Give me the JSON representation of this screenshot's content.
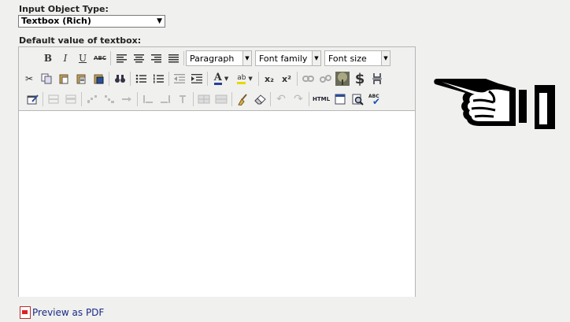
{
  "form": {
    "input_type_label": "Input Object Type:",
    "input_type_value": "Textbox (Rich)",
    "default_value_label": "Default value of textbox:"
  },
  "toolbar": {
    "row1": {
      "bold": "B",
      "italic": "I",
      "underline": "U",
      "strikethrough": "ABC",
      "format_select": "Paragraph",
      "font_family_select": "Font family",
      "font_size_select": "Font size"
    },
    "row2": {
      "subscript": "x₂",
      "superscript": "x²",
      "dollar": "$"
    },
    "row3": {
      "html": "HTML",
      "spellcheck": "ABC"
    }
  },
  "footer": {
    "preview_pdf": "Preview as PDF"
  },
  "icons": {
    "pointing_hand": "hand-pointing-left-icon"
  },
  "colors": {
    "background": "#f0f0ee",
    "link": "#1a2a86"
  }
}
